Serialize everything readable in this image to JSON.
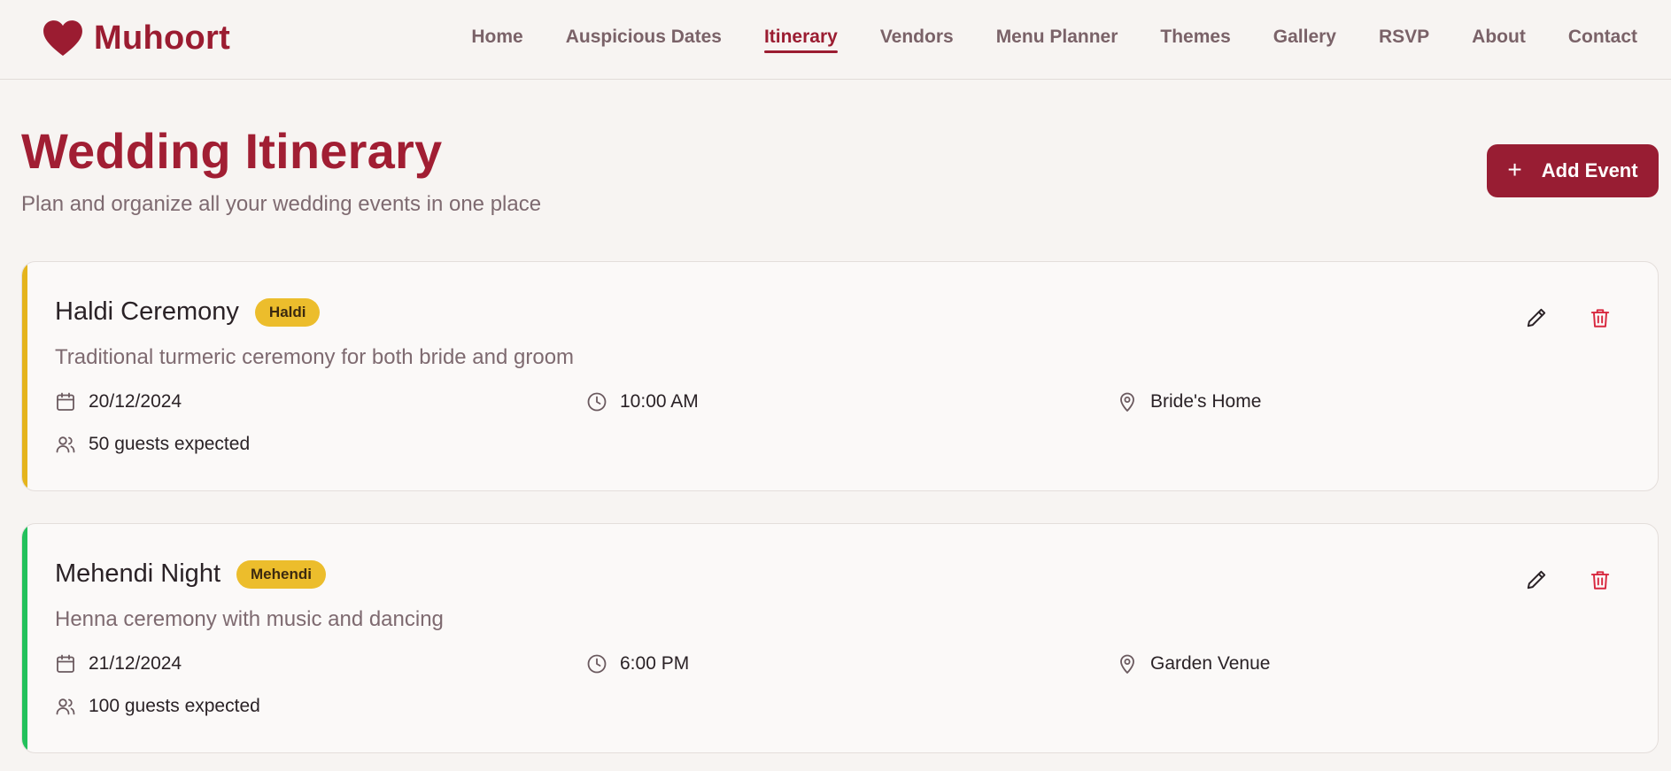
{
  "brand": {
    "name": "Muhoort",
    "logo_icon": "heart-icon"
  },
  "nav": {
    "items": [
      {
        "label": "Home"
      },
      {
        "label": "Auspicious Dates"
      },
      {
        "label": "Itinerary",
        "active": true
      },
      {
        "label": "Vendors"
      },
      {
        "label": "Menu Planner"
      },
      {
        "label": "Themes"
      },
      {
        "label": "Gallery"
      },
      {
        "label": "RSVP"
      },
      {
        "label": "About"
      },
      {
        "label": "Contact"
      }
    ]
  },
  "page": {
    "title": "Wedding Itinerary",
    "subtitle": "Plan and organize all your wedding events in one place",
    "add_button": {
      "label": "Add Event",
      "icon": "plus-icon"
    }
  },
  "events": [
    {
      "title": "Haldi Ceremony",
      "tag": "Haldi",
      "accent": "#e5b41c",
      "description": "Traditional turmeric ceremony for both bride and groom",
      "date": "20/12/2024",
      "time": "10:00 AM",
      "location": "Bride's Home",
      "guests": "50 guests expected"
    },
    {
      "title": "Mehendi Night",
      "tag": "Mehendi",
      "accent": "#22c15c",
      "description": "Henna ceremony with music and dancing",
      "date": "21/12/2024",
      "time": "6:00 PM",
      "location": "Garden Venue",
      "guests": "100 guests expected"
    }
  ],
  "colors": {
    "brand": "#9b1c31",
    "background": "#f7f4f2",
    "badge": "#ecbd2c",
    "delete": "#d8283f"
  }
}
